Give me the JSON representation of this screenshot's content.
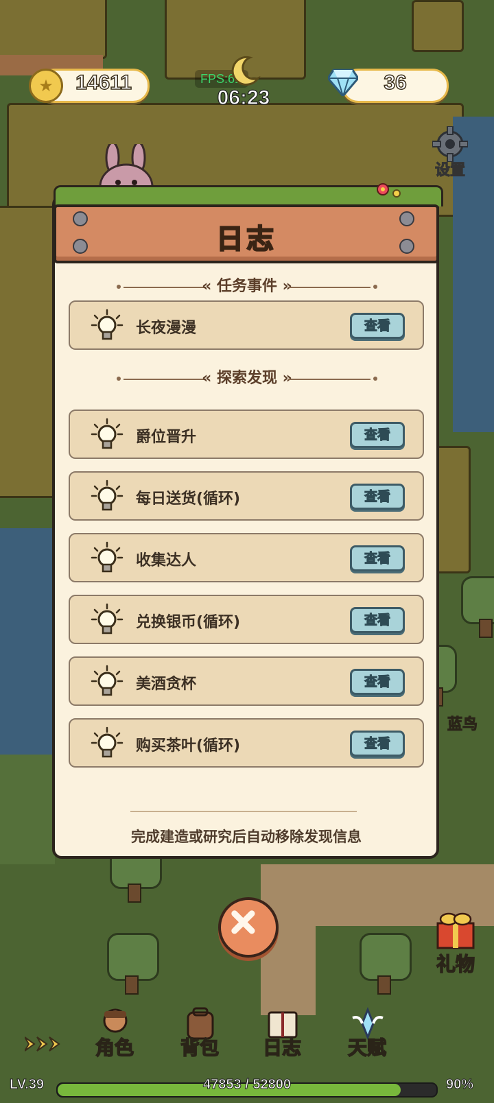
{
  "hud": {
    "coins": "14611",
    "gems": "36",
    "fps_label": "FPS:61",
    "clock": "06:23",
    "settings_label": "设置"
  },
  "modal": {
    "title": "日志",
    "section_tasks": "任务事件",
    "section_discover": "探索发现",
    "task_items": [
      {
        "name": "长夜漫漫",
        "button": "查看"
      }
    ],
    "discover_items": [
      {
        "name": "爵位晋升",
        "button": "查看"
      },
      {
        "name": "每日送货(循环)",
        "button": "查看"
      },
      {
        "name": "收集达人",
        "button": "查看"
      },
      {
        "name": "兑换银币(循环)",
        "button": "查看"
      },
      {
        "name": "美酒贪杯",
        "button": "查看"
      },
      {
        "name": "购买茶叶(循环)",
        "button": "查看"
      }
    ],
    "footer_note": "完成建造或研究后自动移除发现信息"
  },
  "world": {
    "npc_label": "蓝鸟",
    "gift_label": "礼物"
  },
  "nav": {
    "items": [
      {
        "label": "角色",
        "icon": "character-icon"
      },
      {
        "label": "背包",
        "icon": "backpack-icon"
      },
      {
        "label": "日志",
        "icon": "journal-icon"
      },
      {
        "label": "天赋",
        "icon": "talent-icon"
      }
    ]
  },
  "player": {
    "level": "LV.39",
    "xp_text": "47853 / 52800",
    "xp_fraction": 0.906,
    "percent": "90%"
  },
  "colors": {
    "accent_gold": "#e7b94a",
    "plank": "#d48a63",
    "view_button": "#a9d3d9",
    "xp_fill": "#78b83c"
  }
}
